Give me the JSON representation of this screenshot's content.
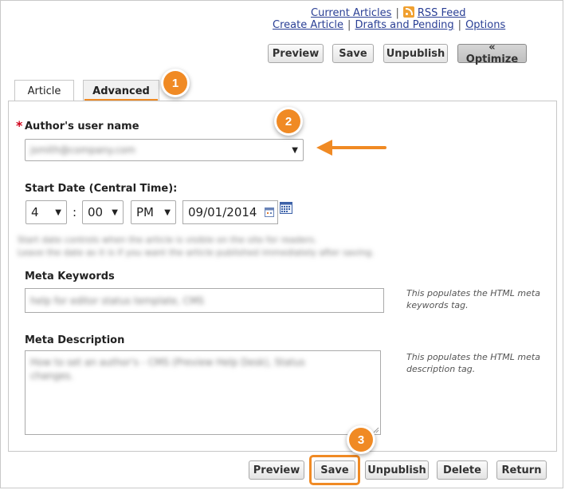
{
  "top_links": {
    "current_articles": "Current Articles",
    "rss_feed": "RSS Feed",
    "create_article": "Create Article",
    "drafts_and_pending": "Drafts and Pending",
    "options": "Options",
    "separator": "|"
  },
  "top_toolbar": {
    "preview": "Preview",
    "save": "Save",
    "unpublish": "Unpublish",
    "optimize": "« Optimize"
  },
  "tabs": [
    {
      "label": "Article"
    },
    {
      "label": "Advanced"
    }
  ],
  "form": {
    "author_label": "Author's user name",
    "required_mark": "*",
    "author_value": "jsmith@company.com",
    "start_date_label": "Start Date (Central Time):",
    "hour": "4",
    "colon": ":",
    "minute": "00",
    "ampm": "PM",
    "date": "09/01/2014",
    "info_line1": "Start date controls when the article is visible on the site for readers.",
    "info_line2": "Leave the date as it is if you want the article published immediately after saving.",
    "meta_keywords_label": "Meta Keywords",
    "meta_keywords_value": "help for editor status template, CMS",
    "meta_keywords_hint": "This populates the HTML meta keywords tag.",
    "meta_description_label": "Meta Description",
    "meta_description_value": "How to set an author's - CMS (Preview Help Desk), Status changes.",
    "meta_description_hint": "This populates the HTML meta description tag."
  },
  "bottom_toolbar": {
    "preview": "Preview",
    "save": "Save",
    "unpublish": "Unpublish",
    "delete": "Delete",
    "return": "Return"
  },
  "markers": [
    "1",
    "2",
    "3"
  ],
  "colors": {
    "accent_orange": "#f08a24",
    "link_blue": "#2a3f95",
    "required_red": "#d0021b"
  },
  "icons": {
    "rss": "rss-feed-icon",
    "calendar": "calendar-icon",
    "arrow": "arrow-left-icon"
  }
}
